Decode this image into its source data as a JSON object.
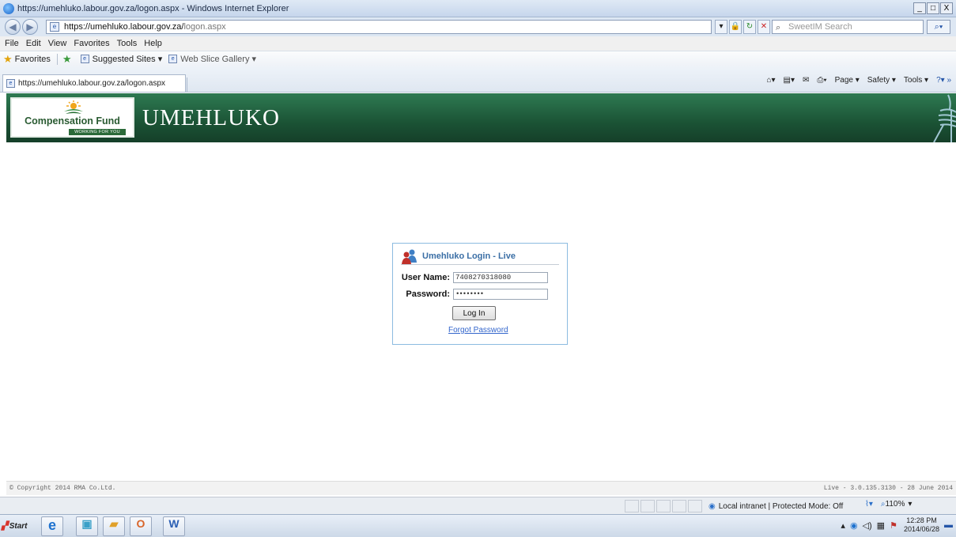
{
  "window": {
    "title": "https://umehluko.labour.gov.za/logon.aspx - Windows Internet Explorer",
    "controls": [
      "_",
      "□",
      "X"
    ]
  },
  "address_bar": {
    "url_host": "https://umehluko.labour.gov.za/",
    "url_path": "logon.aspx",
    "search_placeholder": "SweetIM Search"
  },
  "menu": [
    "File",
    "Edit",
    "View",
    "Favorites",
    "Tools",
    "Help"
  ],
  "favorites_bar": {
    "favorites": "Favorites",
    "suggested": "Suggested Sites ▾",
    "webslice": "Web Slice Gallery ▾"
  },
  "tab": {
    "label": "https://umehluko.labour.gov.za/logon.aspx"
  },
  "command_bar": [
    "Page ▾",
    "Safety ▾",
    "Tools ▾"
  ],
  "banner": {
    "logo_text": "Compensation Fund",
    "logo_tagline": "WORKING FOR YOU",
    "app_title": "UMEHLUKO"
  },
  "login": {
    "title": "Umehluko Login - Live",
    "username_label": "User Name:",
    "username_value": "7408270318080",
    "password_label": "Password:",
    "password_value": "••••••••",
    "button_label": "Log In",
    "forgot_link": "Forgot Password"
  },
  "footer": {
    "copyright": "© Copyright 2014 RMA Co.Ltd.",
    "version": "Live - 3.0.135.3130 - 28 June 2014"
  },
  "status_bar": {
    "zone": "Local intranet | Protected Mode: Off",
    "zoom": "110%"
  },
  "taskbar": {
    "start": "Start",
    "time": "12:28 PM",
    "date": "2014/06/28"
  },
  "colors": {
    "banner_green": "#1b5335",
    "login_title": "#3a6ea5",
    "link": "#3366cc"
  }
}
